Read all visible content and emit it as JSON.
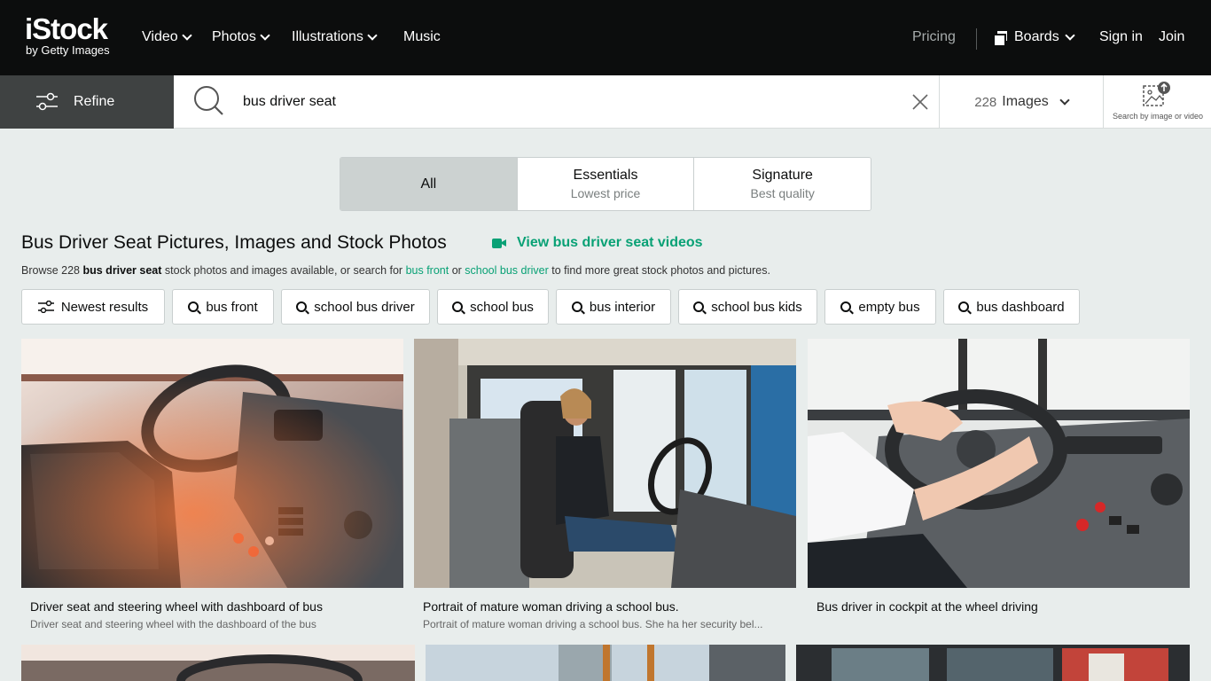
{
  "brand": {
    "name": "iStock",
    "tagline": "by Getty Images"
  },
  "nav": {
    "items": [
      {
        "label": "Video",
        "dropdown": true
      },
      {
        "label": "Photos",
        "dropdown": true
      },
      {
        "label": "Illustrations",
        "dropdown": true
      },
      {
        "label": "Music",
        "dropdown": false
      }
    ],
    "pricing": "Pricing",
    "boards": "Boards",
    "sign_in": "Sign in",
    "join": "Join"
  },
  "search": {
    "refine_label": "Refine",
    "query": "bus driver seat",
    "result_count": "228",
    "media_type": "Images",
    "search_by_image_label": "Search by image or video"
  },
  "license_tabs": [
    {
      "title": "All",
      "subtitle": "",
      "active": true
    },
    {
      "title": "Essentials",
      "subtitle": "Lowest price",
      "active": false
    },
    {
      "title": "Signature",
      "subtitle": "Best quality",
      "active": false
    }
  ],
  "heading": {
    "title": "Bus Driver Seat Pictures, Images and Stock Photos",
    "video_link": "View bus driver seat videos",
    "browse_prefix": "Browse 228 ",
    "browse_bold": "bus driver seat",
    "browse_mid": " stock photos and images available, or search for ",
    "link1": "bus front",
    "browse_or": " or ",
    "link2": "school bus driver",
    "browse_suffix": " to find more great stock photos and pictures."
  },
  "chips": [
    {
      "label": "Newest results",
      "icon": "sliders-icon"
    },
    {
      "label": "bus front",
      "icon": "search-icon"
    },
    {
      "label": "school bus driver",
      "icon": "search-icon"
    },
    {
      "label": "school bus",
      "icon": "search-icon"
    },
    {
      "label": "bus interior",
      "icon": "search-icon"
    },
    {
      "label": "school bus kids",
      "icon": "search-icon"
    },
    {
      "label": "empty bus",
      "icon": "search-icon"
    },
    {
      "label": "bus dashboard",
      "icon": "search-icon"
    }
  ],
  "results": [
    {
      "caption": "Driver seat and steering wheel with dashboard of bus",
      "description": "Driver seat and steering wheel with the dashboard of the bus"
    },
    {
      "caption": "Portrait of mature woman driving a school bus.",
      "description": "Portrait of mature woman driving a school bus. She ha her security bel..."
    },
    {
      "caption": "Bus driver in cockpit at the wheel driving",
      "description": ""
    }
  ],
  "colors": {
    "accent": "#08a175",
    "topbar": "#0c0d0d",
    "refine_bg": "#3f4242",
    "page_bg": "#e8edec"
  }
}
